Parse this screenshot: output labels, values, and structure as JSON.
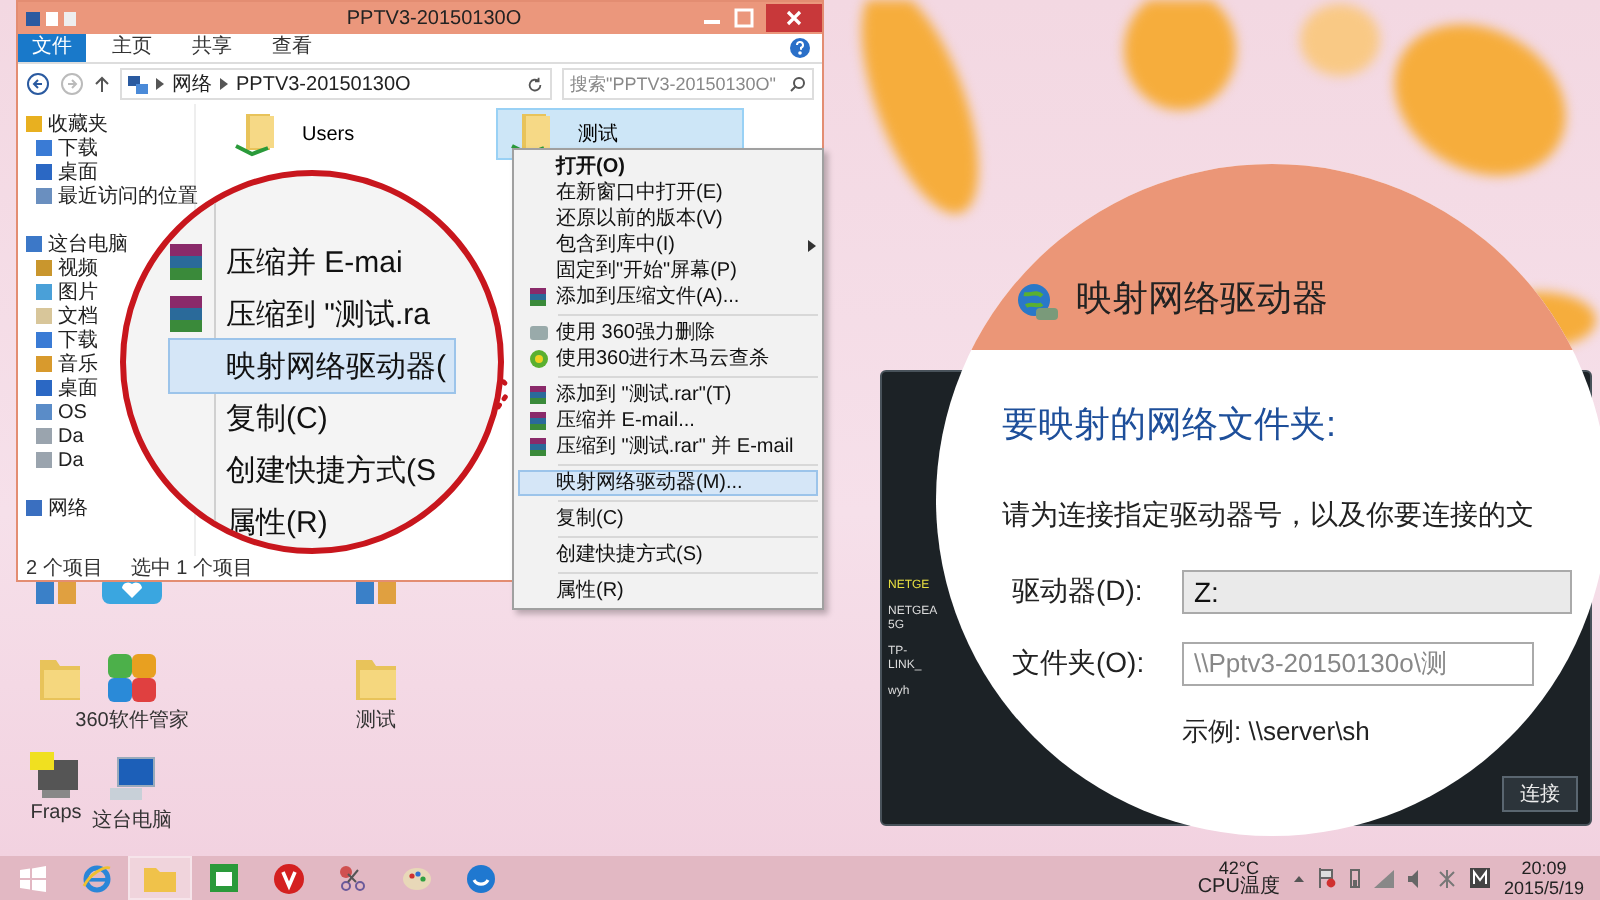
{
  "explorer": {
    "title": "PPTV3-20150130O",
    "ribbon_tabs": [
      {
        "label": "文件",
        "selected": true
      },
      {
        "label": "主页",
        "selected": false
      },
      {
        "label": "共享",
        "selected": false
      },
      {
        "label": "查看",
        "selected": false
      }
    ],
    "address": [
      "网络",
      "PPTV3-20150130O"
    ],
    "search": {
      "placeholder": "搜索\"PPTV3-20150130O\""
    },
    "sidebar": [
      {
        "label": "收藏夹",
        "kind": "star",
        "children": [
          {
            "label": "下载",
            "kind": "download"
          },
          {
            "label": "桌面",
            "kind": "desktop"
          },
          {
            "label": "最近访问的位置",
            "kind": "recent"
          }
        ]
      },
      {
        "label": "这台电脑",
        "kind": "pc",
        "children": [
          {
            "label": "视频",
            "kind": "video"
          },
          {
            "label": "图片",
            "kind": "picture"
          },
          {
            "label": "文档",
            "kind": "document"
          },
          {
            "label": "下载",
            "kind": "download"
          },
          {
            "label": "音乐",
            "kind": "music"
          },
          {
            "label": "桌面",
            "kind": "desktop"
          },
          {
            "label": "OS",
            "kind": "drive"
          },
          {
            "label": "Da",
            "kind": "drive2"
          },
          {
            "label": "Da",
            "kind": "drive2"
          }
        ]
      },
      {
        "label": "网络",
        "kind": "network"
      }
    ],
    "files": [
      {
        "name": "Users",
        "selected": false
      },
      {
        "name": "测试",
        "selected": true
      }
    ],
    "status": [
      "2 个项目",
      "选中 1 个项目"
    ]
  },
  "context_menu": [
    [
      {
        "label": "打开(O)",
        "kind": "plain",
        "default": true,
        "submenu": false,
        "selected": false
      },
      {
        "label": "在新窗口中打开(E)",
        "kind": "plain",
        "default": false,
        "submenu": false,
        "selected": false
      },
      {
        "label": "还原以前的版本(V)",
        "kind": "plain",
        "default": false,
        "submenu": false,
        "selected": false
      },
      {
        "label": "包含到库中(I)",
        "kind": "plain",
        "default": false,
        "submenu": true,
        "selected": false
      },
      {
        "label": "固定到\"开始\"屏幕(P)",
        "kind": "plain",
        "default": false,
        "submenu": false,
        "selected": false
      },
      {
        "label": "添加到压缩文件(A)...",
        "kind": "archive",
        "default": false,
        "submenu": false,
        "selected": false
      }
    ],
    [
      {
        "label": "使用 360强力删除",
        "kind": "shredder",
        "default": false,
        "submenu": false,
        "selected": false
      },
      {
        "label": "使用360进行木马云查杀",
        "kind": "scan",
        "default": false,
        "submenu": false,
        "selected": false
      }
    ],
    [
      {
        "label": "添加到 \"测试.rar\"(T)",
        "kind": "archive",
        "default": false,
        "submenu": false,
        "selected": false
      },
      {
        "label": "压缩并 E-mail...",
        "kind": "archive",
        "default": false,
        "submenu": false,
        "selected": false
      },
      {
        "label": "压缩到 \"测试.rar\" 并 E-mail",
        "kind": "archive",
        "default": false,
        "submenu": false,
        "selected": false
      }
    ],
    [
      {
        "label": "映射网络驱动器(M)...",
        "kind": "plain",
        "default": false,
        "submenu": false,
        "selected": true
      }
    ],
    [
      {
        "label": "复制(C)",
        "kind": "plain",
        "default": false,
        "submenu": false,
        "selected": false
      }
    ],
    [
      {
        "label": "创建快捷方式(S)",
        "kind": "plain",
        "default": false,
        "submenu": false,
        "selected": false
      }
    ],
    [
      {
        "label": "属性(R)",
        "kind": "plain",
        "default": false,
        "submenu": false,
        "selected": false
      }
    ]
  ],
  "zoom_left": [
    {
      "label": "压缩并 E-mai",
      "kind": "archive",
      "selected": false
    },
    {
      "label": "压缩到 \"测试.ra",
      "kind": "archive",
      "selected": false
    },
    {
      "label": "映射网络驱动器(",
      "kind": "plain",
      "selected": true
    },
    {
      "label": "复制(C)",
      "kind": "plain",
      "selected": false
    },
    {
      "label": "创建快捷方式(S",
      "kind": "plain",
      "selected": false
    },
    {
      "label": "属性(R)",
      "kind": "plain",
      "selected": false
    }
  ],
  "zoom_right": {
    "title": "映射网络驱动器",
    "heading": "要映射的网络文件夹:",
    "description": "请为连接指定驱动器号，以及你要连接的文",
    "drive": {
      "label": "驱动器(D):",
      "value": "Z:"
    },
    "folder": {
      "label": "文件夹(O):",
      "value": "\\\\Pptv3-20150130o\\测"
    },
    "example": "示例: \\\\server\\sh"
  },
  "wifi_panel": {
    "networks": [
      {
        "name": "NETGE",
        "selected": true
      },
      {
        "name": "NETGEA 5G",
        "selected": false
      },
      {
        "name": "TP-LINK_",
        "selected": false
      },
      {
        "name": "wyh",
        "selected": false
      }
    ],
    "button": "连接"
  },
  "desktop_icons": [
    {
      "kind": "app"
    },
    {
      "kind": "heart"
    },
    {
      "kind": "app"
    },
    {
      "kind": "folder"
    },
    {
      "kind": "store360",
      "label": "360软件管家"
    },
    {
      "kind": "folder",
      "label": "测试"
    },
    {
      "kind": "fraps",
      "label": "Fraps"
    },
    {
      "kind": "computer",
      "label": "这台电脑"
    }
  ],
  "taskbar": {
    "apps": [
      {
        "kind": "start",
        "selected": false
      },
      {
        "kind": "ie",
        "selected": false
      },
      {
        "kind": "explorer",
        "selected": true
      },
      {
        "kind": "store",
        "selected": false
      },
      {
        "kind": "v",
        "selected": false
      },
      {
        "kind": "tool",
        "selected": false
      },
      {
        "kind": "paint",
        "selected": false
      },
      {
        "kind": "globe",
        "selected": false
      }
    ],
    "temperature": "42°C",
    "temperature_label": "CPU温度",
    "time": "20:09",
    "date": "2015/5/19"
  }
}
